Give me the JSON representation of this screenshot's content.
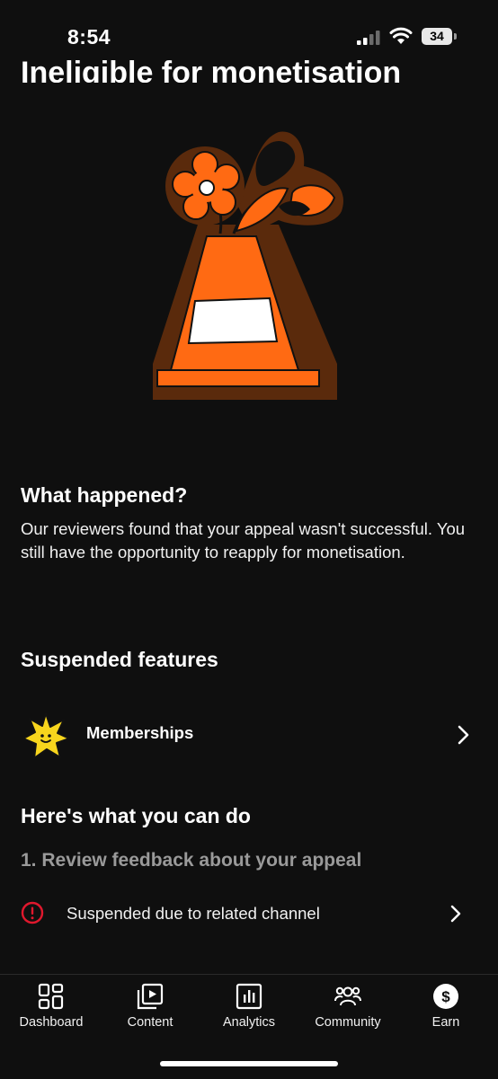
{
  "status_bar": {
    "time": "8:54",
    "battery": "34"
  },
  "page": {
    "title": "Ineligible for monetisation"
  },
  "what_happened": {
    "heading": "What happened?",
    "body": "Our reviewers found that your appeal wasn't successful. You still have the opportunity to reapply for monetisation."
  },
  "suspended_features": {
    "heading": "Suspended features",
    "items": [
      {
        "label": "Memberships",
        "icon": "star-icon"
      }
    ]
  },
  "what_you_can_do": {
    "heading": "Here's what you can do",
    "step_1": "1. Review feedback about your appeal",
    "notice": {
      "label": "Suspended due to related channel",
      "icon": "alert-circle-icon"
    }
  },
  "bottom_nav": {
    "items": [
      {
        "label": "Dashboard",
        "icon": "dashboard-icon"
      },
      {
        "label": "Content",
        "icon": "content-icon"
      },
      {
        "label": "Analytics",
        "icon": "analytics-icon"
      },
      {
        "label": "Community",
        "icon": "community-icon"
      },
      {
        "label": "Earn",
        "icon": "earn-icon"
      }
    ]
  },
  "colors": {
    "background": "#0f0f0f",
    "accent_orange": "#ff6a13",
    "alert_red": "#e0182d",
    "star_yellow": "#f7d51d"
  }
}
